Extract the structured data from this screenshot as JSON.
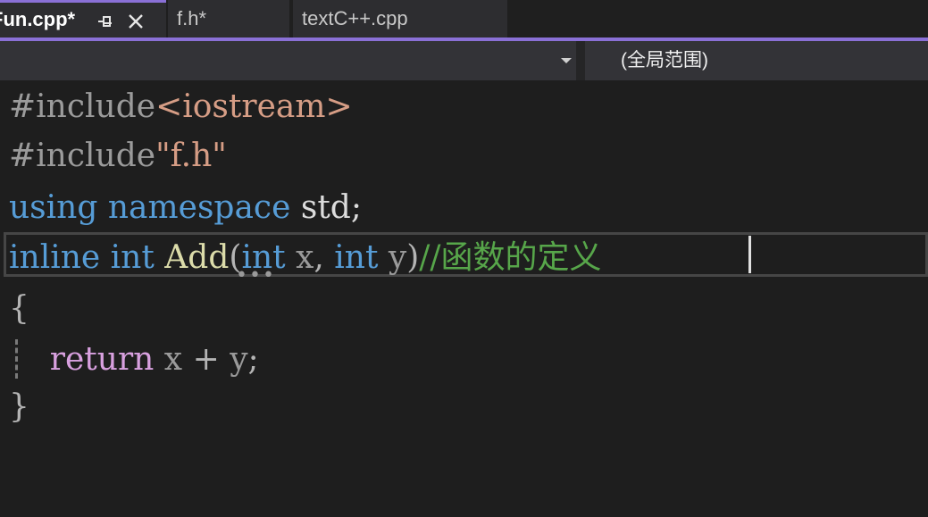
{
  "tabs": [
    {
      "label": "Fun.cpp*",
      "active": true
    },
    {
      "label": "f.h*",
      "active": false
    },
    {
      "label": "textC++.cpp",
      "active": false
    }
  ],
  "navbar": {
    "scope": "(全局范围)"
  },
  "code": {
    "l1": {
      "directive": "#include",
      "header": "<iostream>"
    },
    "l2": {
      "directive": "#include",
      "header": "\"f.h\""
    },
    "l3": {
      "kw1": "using",
      "kw2": "namespace",
      "rest": "std;"
    },
    "l4": {
      "kw_inline": "inline",
      "kw_int": "int",
      "fn": "Add",
      "open": "(",
      "kw_int2": "int",
      "p1": "x",
      "comma": ",",
      "kw_int3": "int",
      "p2": "y",
      "close": ")",
      "comment": "//函数的定义"
    },
    "l5": {
      "brace": "{"
    },
    "l6": {
      "kw": "return",
      "a": "x",
      "op": "+",
      "b": "y",
      "semi": ";"
    },
    "l7": {
      "brace": "}"
    }
  },
  "colors": {
    "accent": "#8a70d6",
    "keyword": "#569cd6",
    "string": "#d69d85",
    "function": "#dcdcaa",
    "comment": "#57a64a",
    "control": "#d8a0df"
  }
}
